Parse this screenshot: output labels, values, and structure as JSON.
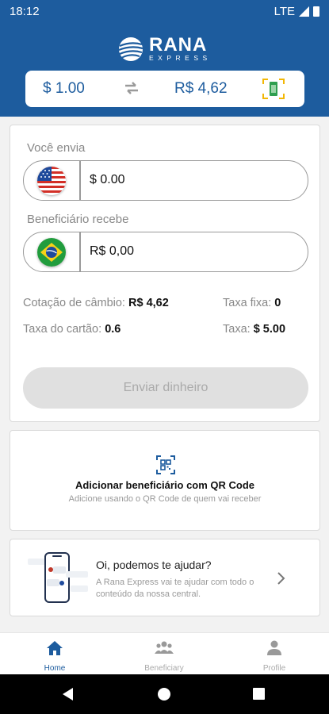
{
  "status_bar": {
    "time": "18:12",
    "network": "LTE"
  },
  "brand": {
    "name": "RANA",
    "tagline": "EXPRESS"
  },
  "rate_bar": {
    "from_amount": "$ 1.00",
    "to_amount": "R$ 4,62"
  },
  "send_card": {
    "you_send_label": "Você envia",
    "you_send_value": "$ 0.00",
    "recipient_gets_label": "Beneficiário recebe",
    "recipient_gets_value": "R$ 0,00",
    "exchange_rate_label": "Cotação de câmbio:",
    "exchange_rate_value": "R$ 4,62",
    "fixed_fee_label": "Taxa fixa:",
    "fixed_fee_value": "0",
    "card_fee_label": "Taxa do cartão:",
    "card_fee_value": "0.6",
    "fee_label": "Taxa:",
    "fee_value": "$ 5.00",
    "send_button": "Enviar dinheiro"
  },
  "qr_card": {
    "icon": "qr-scan-icon",
    "title": "Adicionar beneficiário com QR Code",
    "description": "Adicione usando o QR Code de quem vai receber"
  },
  "help_card": {
    "title": "Oi, podemos te ajudar?",
    "description": "A Rana Express vai te ajudar com todo o conteúdo da nossa central."
  },
  "bottom_nav": {
    "items": [
      {
        "label": "Home",
        "icon": "home-icon",
        "active": true
      },
      {
        "label": "Beneficiary",
        "icon": "people-icon",
        "active": false
      },
      {
        "label": "Profile",
        "icon": "person-icon",
        "active": false
      }
    ]
  },
  "colors": {
    "primary": "#1d5c9e",
    "background": "#f2f2f2",
    "disabled": "#e0e0e0"
  }
}
